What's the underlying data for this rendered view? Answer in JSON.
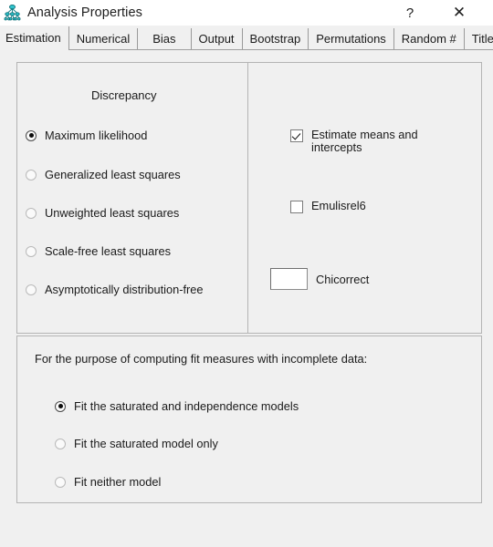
{
  "window": {
    "title": "Analysis Properties",
    "icon": "path-diagram-icon",
    "help_label": "?",
    "close_label": "✕"
  },
  "tabs": [
    {
      "label": "Estimation",
      "active": true
    },
    {
      "label": "Numerical",
      "active": false
    },
    {
      "label": "Bias",
      "active": false
    },
    {
      "label": "Output",
      "active": false
    },
    {
      "label": "Bootstrap",
      "active": false
    },
    {
      "label": "Permutations",
      "active": false
    },
    {
      "label": "Random #",
      "active": false
    },
    {
      "label": "Title",
      "active": false
    }
  ],
  "discrepancy": {
    "heading": "Discrepancy",
    "options": [
      {
        "label": "Maximum likelihood",
        "checked": true
      },
      {
        "label": "Generalized least squares",
        "checked": false
      },
      {
        "label": "Unweighted least squares",
        "checked": false
      },
      {
        "label": "Scale-free least squares",
        "checked": false
      },
      {
        "label": "Asymptotically distribution-free",
        "checked": false
      }
    ]
  },
  "options_panel": {
    "estimate_means": {
      "label": "Estimate means and intercepts",
      "checked": true
    },
    "emulisrel6": {
      "label": "Emulisrel6",
      "checked": false
    },
    "chicorrect": {
      "label": "Chicorrect",
      "value": "",
      "placeholder": ""
    }
  },
  "fit_measures": {
    "prompt": "For the purpose of computing fit measures with incomplete data:",
    "options": [
      {
        "label": "Fit the saturated and independence models",
        "checked": true
      },
      {
        "label": "Fit the saturated model only",
        "checked": false
      },
      {
        "label": "Fit neither model",
        "checked": false
      }
    ]
  },
  "colors": {
    "window_background": "#f0f0f0",
    "titlebar_background": "#ffffff",
    "group_border": "#b4b4b4",
    "icon_accent": "#1aa7b0",
    "text": "#1a1a1a"
  }
}
